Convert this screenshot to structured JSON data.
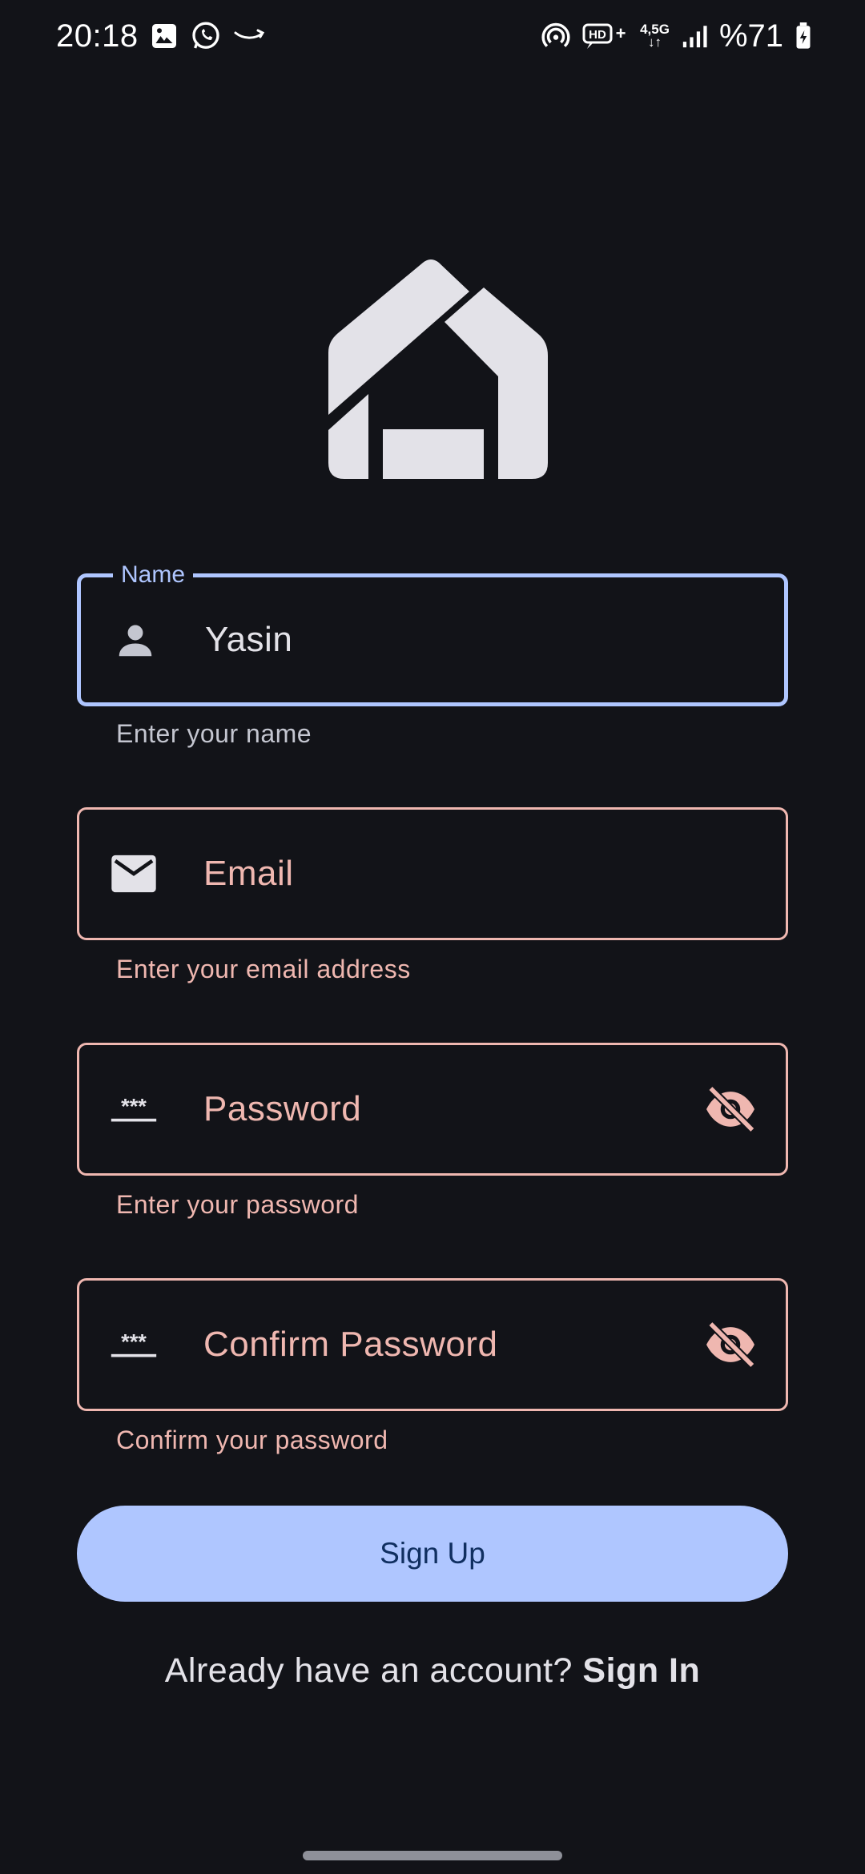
{
  "status_bar": {
    "time": "20:18",
    "battery": "%71",
    "network_label_top": "4,5G",
    "network_label_bottom": "↓↑",
    "hd_label": "HD+",
    "icons": [
      "image-icon",
      "whatsapp-icon",
      "amazon-icon",
      "hotspot-icon",
      "hd-voice-icon",
      "network-icon",
      "signal-icon",
      "battery-icon"
    ]
  },
  "logo": {
    "icon": "home-logo-icon"
  },
  "form": {
    "name": {
      "label": "Name",
      "value": "Yasin",
      "helper": "Enter your name",
      "icon": "person-icon"
    },
    "email": {
      "placeholder": "Email",
      "helper": "Enter your email address",
      "icon": "mail-icon"
    },
    "password": {
      "placeholder": "Password",
      "helper": "Enter your password",
      "icon": "password-icon",
      "trailing_icon": "visibility-off-icon"
    },
    "confirm_password": {
      "placeholder": "Confirm Password",
      "helper": "Confirm your password",
      "icon": "password-icon",
      "trailing_icon": "visibility-off-icon"
    }
  },
  "signup_button": {
    "label": "Sign Up"
  },
  "signin_prompt": {
    "text": "Already have an account?",
    "link": "Sign In"
  },
  "colors": {
    "background": "#121318",
    "primary": "#afc6ff",
    "error": "#efb7b0",
    "on_primary": "#102f60"
  }
}
